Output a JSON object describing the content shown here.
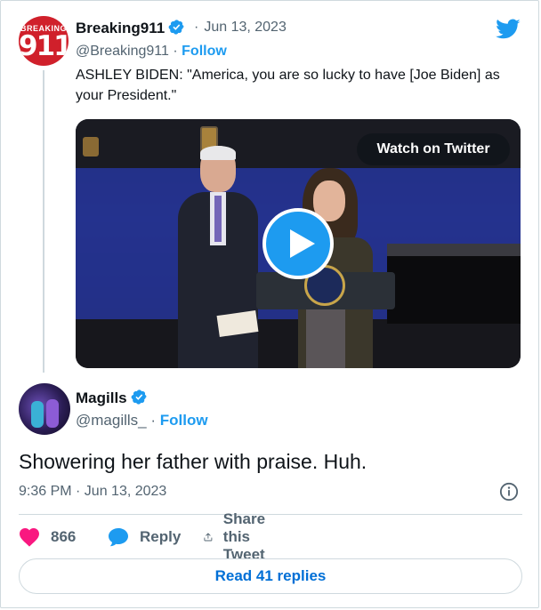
{
  "quoted_tweet": {
    "author_name": "Breaking911",
    "avatar_text_top": "BREAKING",
    "avatar_text_main": "911",
    "date_sep": "·",
    "date": "Jun 13, 2023",
    "handle": "@Breaking911",
    "handle_sep": "·",
    "follow_label": "Follow",
    "text": "ASHLEY BIDEN: \"America, you are so lucky to have [Joe Biden] as your President.\"",
    "video": {
      "watch_label": "Watch on Twitter"
    }
  },
  "tweet": {
    "author_name": "Magills",
    "handle": "@magills_",
    "handle_sep": "·",
    "follow_label": "Follow",
    "text": "Showering her father with praise. Huh.",
    "timestamp": "9:36 PM · Jun 13, 2023"
  },
  "actions": {
    "like_count": "866",
    "reply_label": "Reply",
    "share_label": "Share this Tweet"
  },
  "read_replies_label": "Read 41 replies",
  "colors": {
    "accent": "#1d9bf0",
    "like": "#f91880",
    "text": "#0f1419",
    "muted": "#536471",
    "border": "#cfd9de"
  },
  "icons": [
    "verified-badge-icon",
    "twitter-bird-icon",
    "play-icon",
    "heart-icon",
    "reply-bubble-icon",
    "share-icon",
    "info-icon"
  ]
}
